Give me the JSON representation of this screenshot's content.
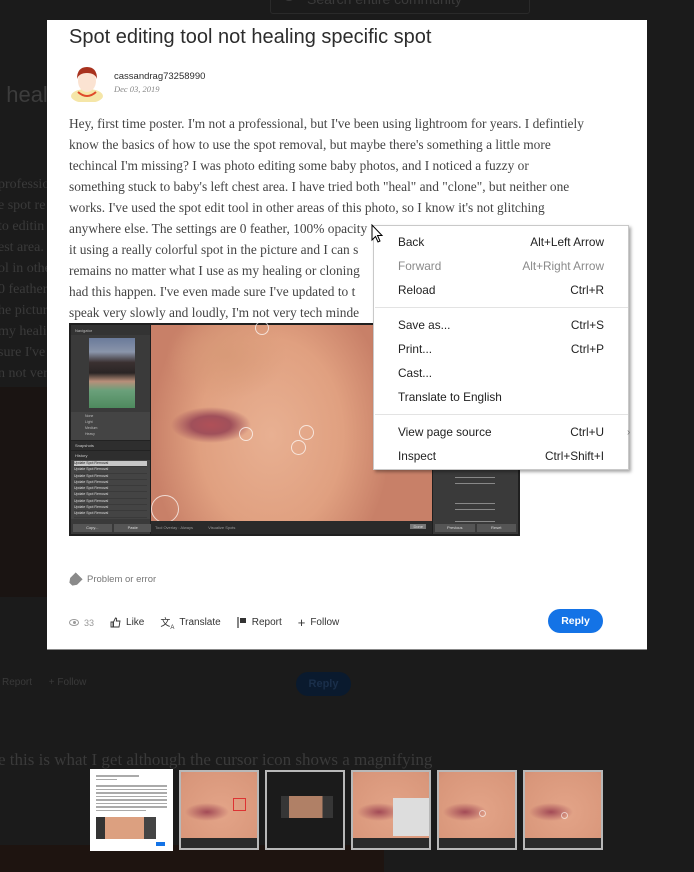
{
  "background_page": {
    "search_placeholder": "Search entire community",
    "title_fragment": "t heal",
    "text_fragments": [
      "professio",
      "e spot re",
      "to editin",
      "est area.",
      "ol in othe",
      "0 feather,",
      "he pictur",
      "my heali",
      "sure I've",
      "n not ver"
    ],
    "actions": [
      "Report",
      "+ Follow"
    ],
    "reply_label": "Reply",
    "caption": "e this is what I get although the cursor icon shows a magnifying"
  },
  "post": {
    "title": "Spot editing tool not healing specific spot",
    "author": "cassandrag73258990",
    "date": "Dec 03, 2019",
    "body_lines": [
      "Hey, first time poster. I'm not a professional, but I've been using lightroom for years. I defintiely",
      "know the basics of how to use the spot removal, but maybe there's something a little more",
      "techincal I'm missing? I was photo editing some baby photos, and I noticed a fuzzy or",
      "something stuck to baby's left chest area. I have tried both \"heal\" and \"clone\", but neither one",
      "works. I've used the spot edit tool in other areas of this photo, so I know it's not glitching",
      "anywhere else. The settings are 0 feather, 100% opacity",
      "it using a really colorful spot in the picture and I can s",
      "remains no matter what I use as my healing or cloning",
      "had this happen. I've even made sure I've updated to t",
      "speak very slowly and loudly, I'm not very tech minde"
    ],
    "screenshot": {
      "panel_navigator": "Navigator",
      "panel_snapshots": "Snapshots",
      "panel_history": "History",
      "history_items": [
        "Update Spot Removal",
        "Update Spot Removal",
        "Update Spot Removal",
        "Update Spot Removal",
        "Update Spot Removal",
        "Update Spot Removal",
        "Update Spot Removal",
        "Update Spot Removal",
        "Update Spot Removal",
        "Update Spot Removal"
      ],
      "preset_items": [
        "None",
        "Light",
        "Medium",
        "Heavy"
      ],
      "copy_label": "Copy...",
      "paste_label": "Paste",
      "toolbar_text": "Tool Overlay : Always",
      "visualize_label": "Visualize Spots",
      "done_label": "Done",
      "previous_label": "Previous",
      "reset_label": "Reset"
    },
    "tag": "Problem or error",
    "views": "33",
    "actions": {
      "like": "Like",
      "translate": "Translate",
      "report": "Report",
      "follow": "Follow"
    },
    "reply_label": "Reply"
  },
  "context_menu": {
    "groups": [
      [
        {
          "label": "Back",
          "shortcut": "Alt+Left Arrow",
          "disabled": false
        },
        {
          "label": "Forward",
          "shortcut": "Alt+Right Arrow",
          "disabled": true
        },
        {
          "label": "Reload",
          "shortcut": "Ctrl+R",
          "disabled": false
        }
      ],
      [
        {
          "label": "Save as...",
          "shortcut": "Ctrl+S",
          "disabled": false
        },
        {
          "label": "Print...",
          "shortcut": "Ctrl+P",
          "disabled": false
        },
        {
          "label": "Cast...",
          "shortcut": "",
          "disabled": false
        },
        {
          "label": "Translate to English",
          "shortcut": "",
          "disabled": false
        }
      ],
      [
        {
          "label": "View page source",
          "shortcut": "Ctrl+U",
          "disabled": false
        },
        {
          "label": "Inspect",
          "shortcut": "Ctrl+Shift+I",
          "disabled": false
        }
      ]
    ]
  },
  "thumbnails": {
    "count": 6,
    "active_index": 0
  },
  "colors": {
    "reply_blue": "#1473e6",
    "overlay": "#1b1b1b"
  }
}
